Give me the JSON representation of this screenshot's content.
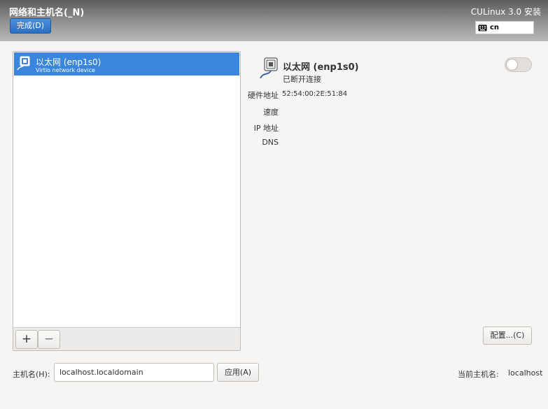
{
  "header": {
    "spoke_title": "网络和主机名(_N)",
    "done_label": "完成(D)",
    "product_title": "CULinux 3.0 安装",
    "keyboard_layout": "cn"
  },
  "devices": [
    {
      "name": "以太网 (enp1s0)",
      "description": "Virtio network device",
      "selected": true
    }
  ],
  "list_toolbar": {
    "add_label": "+",
    "remove_label": "−"
  },
  "detail": {
    "name": "以太网 (enp1s0)",
    "status": "已断开连接",
    "enabled": false,
    "props": {
      "hw_label": "硬件地址",
      "hw_value": "52:54:00:2E:51:84",
      "speed_label": "速度",
      "ip_label": "IP 地址",
      "dns_label": "DNS"
    },
    "config_label": "配置...(C)"
  },
  "hostname": {
    "label": "主机名(H):",
    "value": "localhost.localdomain",
    "apply_label": "应用(A)",
    "current_label": "当前主机名:",
    "current_value": "localhost"
  },
  "colors": {
    "accent": "#3a86de",
    "done_button": "#2a6fc4",
    "icon": "#3465a4"
  },
  "icons": {
    "keyboard": "keyboard-icon",
    "ethernet": "ethernet-icon"
  }
}
